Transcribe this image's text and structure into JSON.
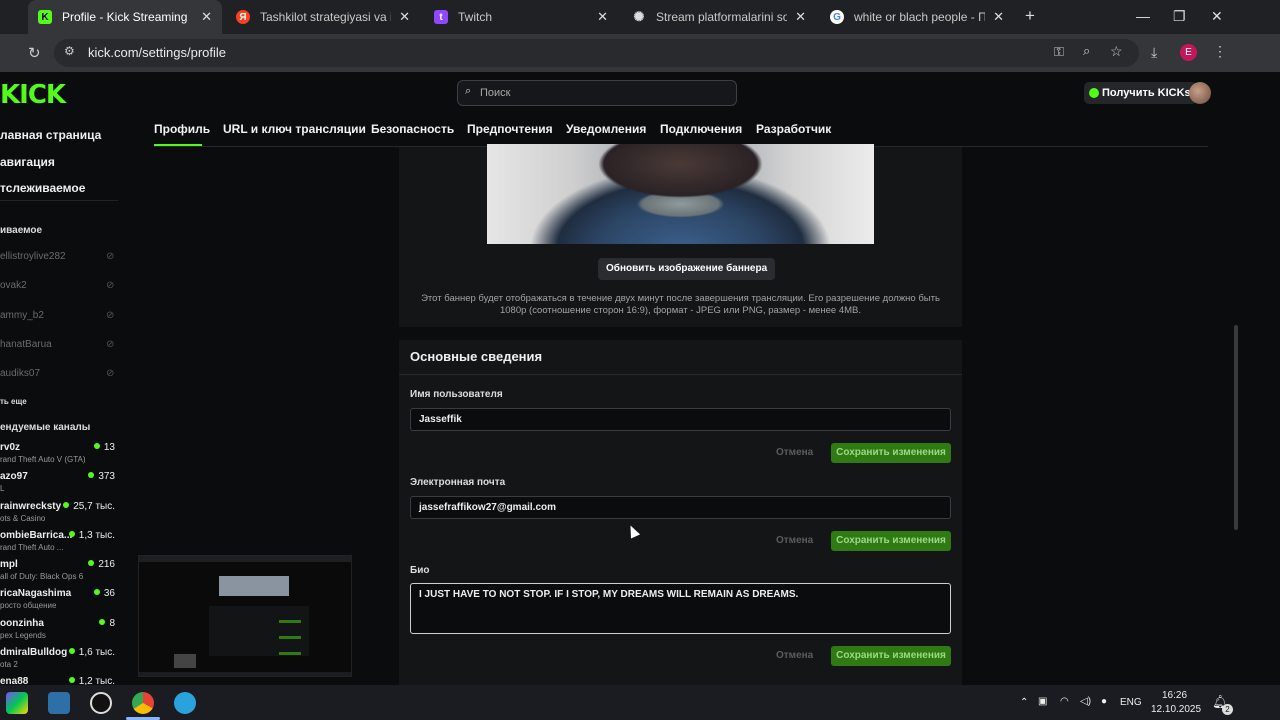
{
  "browser": {
    "tabs": [
      {
        "title": "Profile - Kick Streaming",
        "active": true,
        "icon": "kick-icon"
      },
      {
        "title": "Tashkilot strategiyasi va inson",
        "active": false,
        "icon": "yandex-icon"
      },
      {
        "title": "Twitch",
        "active": false,
        "icon": "twitch-icon"
      },
      {
        "title": "Stream platformalarini solishtir",
        "active": false,
        "icon": "openai-icon"
      },
      {
        "title": "white or blach people - Поиск",
        "active": false,
        "icon": "google-icon"
      }
    ],
    "new_tab": "+",
    "url": "kick.com/settings/profile",
    "profile_letter": "E"
  },
  "header": {
    "logo": "KICK",
    "search_placeholder": "Поиск",
    "get_kicks": "Получить KICKs"
  },
  "sidebar": {
    "nav": [
      "лавная страница",
      "авигация",
      "тслеживаемое"
    ],
    "following_heading": "иваемое",
    "following": [
      "ellistroylive282",
      "ovak2",
      "ammy_b2",
      "hanatBarua",
      "audiks07"
    ],
    "show_more": "ть еще",
    "recommended_heading": "ендуемые каналы",
    "recommended": [
      {
        "name": "rv0z",
        "game": "rand Theft Auto V (GTA)",
        "viewers": "13"
      },
      {
        "name": "azo97",
        "game": "L",
        "viewers": "373"
      },
      {
        "name": "rainwrecksty",
        "game": "ots & Casino",
        "viewers": "25,7 тыс."
      },
      {
        "name": "ombieBarrica...",
        "game": "rand Theft Auto ...",
        "viewers": "1,3 тыс."
      },
      {
        "name": "mpl",
        "game": "all of Duty: Black Ops 6",
        "viewers": "216"
      },
      {
        "name": "ricaNagashima",
        "game": "росто общение",
        "viewers": "36"
      },
      {
        "name": "oonzinha",
        "game": "pex Legends",
        "viewers": "8"
      },
      {
        "name": "dmiralBulldog",
        "game": "ota 2",
        "viewers": "1,6 тыс."
      },
      {
        "name": "ena88",
        "game": "",
        "viewers": "1,2 тыс."
      }
    ]
  },
  "settings_tabs": [
    "Профиль",
    "URL и ключ трансляции",
    "Безопасность",
    "Предпочтения",
    "Уведомления",
    "Подключения",
    "Разработчик"
  ],
  "banner": {
    "update_button": "Обновить изображение баннера",
    "note_line1": "Этот баннер будет отображаться в течение двух минут после завершения трансляции. Его разрешение должно быть",
    "note_line2": "1080p (соотношение сторон 16:9), формат - JPEG или PNG, размер - менее 4MB."
  },
  "basic_info": {
    "title": "Основные сведения",
    "username_label": "Имя пользователя",
    "username_value": "Jasseffik",
    "email_label": "Электронная почта",
    "email_value": "jassefraffikow27@gmail.com",
    "bio_label": "Био",
    "bio_value": "I JUST HAVE TO NOT STOP. IF I STOP, MY DREAMS WILL REMAIN AS DREAMS.",
    "cancel": "Отмена",
    "save": "Сохранить изменения"
  },
  "taskbar": {
    "lang": "ENG",
    "time": "16:26",
    "date": "12.10.2025",
    "notifications": "2"
  },
  "colors": {
    "accent": "#53fc18",
    "save_bg": "#2f7a12",
    "page_bg": "#0b0c0e",
    "card_bg": "#141517"
  }
}
